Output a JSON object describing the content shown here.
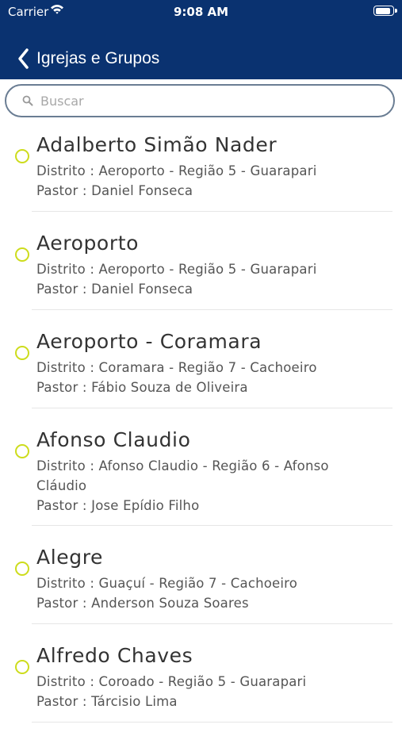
{
  "status_bar": {
    "carrier": "Carrier",
    "time": "9:08 AM"
  },
  "nav": {
    "back_label": "Igrejas e Grupos"
  },
  "search": {
    "placeholder": "Buscar",
    "value": ""
  },
  "labels": {
    "distrito": "Distrito",
    "pastor": "Pastor",
    "separator": " : "
  },
  "colors": {
    "header": "#0a3270",
    "marker": "#cddc1c",
    "search_border": "#6a7d93"
  },
  "items": [
    {
      "name": "Adalberto Simão Nader",
      "distrito": [
        "Aeroporto - Região 5 - Guarapari"
      ],
      "pastor": "Daniel Fonseca"
    },
    {
      "name": "Aeroporto",
      "distrito": [
        "Aeroporto - Região 5 - Guarapari"
      ],
      "pastor": "Daniel Fonseca"
    },
    {
      "name": "Aeroporto - Coramara",
      "distrito": [
        "Coramara - Região 7 - Cachoeiro"
      ],
      "pastor": "Fábio Souza de Oliveira"
    },
    {
      "name": "Afonso Claudio",
      "distrito": [
        "Afonso Claudio - Região 6 - Afonso",
        "Cláudio"
      ],
      "pastor": "Jose Epídio Filho"
    },
    {
      "name": "Alegre",
      "distrito": [
        "Guaçuí - Região 7 - Cachoeiro"
      ],
      "pastor": "Anderson Souza Soares"
    },
    {
      "name": "Alfredo Chaves",
      "distrito": [
        "Coroado - Região 5 - Guarapari"
      ],
      "pastor": "Tárcisio Lima"
    }
  ]
}
